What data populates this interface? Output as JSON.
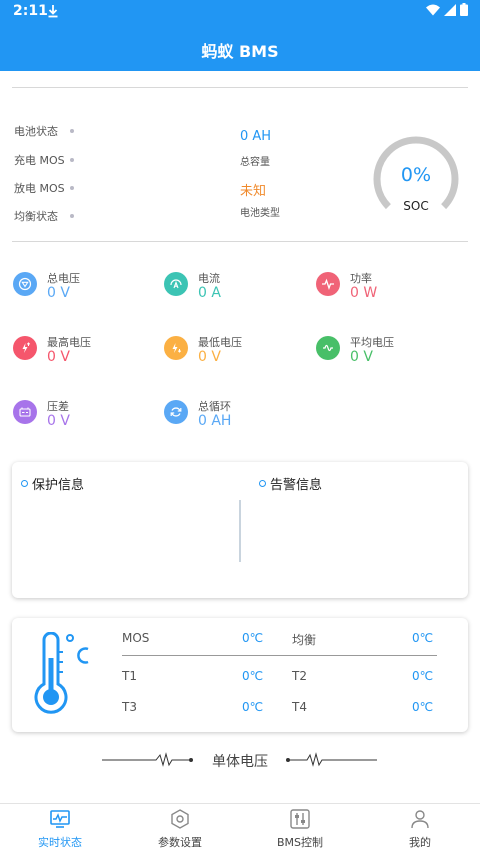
{
  "status_bar": {
    "time": "2:11"
  },
  "app": {
    "title": "蚂蚁 BMS"
  },
  "status": {
    "items": [
      {
        "label": "电池状态"
      },
      {
        "label": "充电 MOS"
      },
      {
        "label": "放电 MOS"
      },
      {
        "label": "均衡状态"
      }
    ],
    "capacity_value": "0 AH",
    "capacity_label": "总容量",
    "battery_type_value": "未知",
    "battery_type_label": "电池类型"
  },
  "soc": {
    "value": "0%",
    "label": "SOC",
    "percent": 0
  },
  "metrics": [
    {
      "label": "总电压",
      "value": "0 V",
      "color": "#5aa8f5",
      "icon": "triangle-down-icon"
    },
    {
      "label": "电流",
      "value": "0 A",
      "color": "#3cc4b4",
      "icon": "current-a-icon"
    },
    {
      "label": "功率",
      "value": "0 W",
      "color": "#f06377",
      "icon": "pulse-icon"
    },
    {
      "label": "最高电压",
      "value": "0 V",
      "color": "#f5566c",
      "icon": "bolt-up-icon"
    },
    {
      "label": "最低电压",
      "value": "0 V",
      "color": "#fbb043",
      "icon": "bolt-down-icon"
    },
    {
      "label": "平均电压",
      "value": "0 V",
      "color": "#48bf68",
      "icon": "wave-icon"
    },
    {
      "label": "压差",
      "value": "0 V",
      "color": "#a774ea",
      "icon": "battery-diff-icon"
    },
    {
      "label": "总循环",
      "value": "0 AH",
      "color": "#5aa8f5",
      "icon": "cycle-icon"
    }
  ],
  "info": {
    "protection_title": "保护信息",
    "alarm_title": "告警信息"
  },
  "temps": {
    "mos_label": "MOS",
    "mos_value": "0℃",
    "balance_label": "均衡",
    "balance_value": "0℃",
    "t1_label": "T1",
    "t1_value": "0℃",
    "t2_label": "T2",
    "t2_value": "0℃",
    "t3_label": "T3",
    "t3_value": "0℃",
    "t4_label": "T4",
    "t4_value": "0℃"
  },
  "cells": {
    "title": "单体电压"
  },
  "nav": [
    {
      "label": "实时状态",
      "icon": "monitor-icon",
      "active": true
    },
    {
      "label": "参数设置",
      "icon": "hexagon-settings-icon",
      "active": false
    },
    {
      "label": "BMS控制",
      "icon": "sliders-icon",
      "active": false
    },
    {
      "label": "我的",
      "icon": "user-icon",
      "active": false
    }
  ],
  "colors": {
    "primary": "#2196f3",
    "battery_type": "#f08a2c",
    "gauge_track": "#c8c8c8"
  }
}
